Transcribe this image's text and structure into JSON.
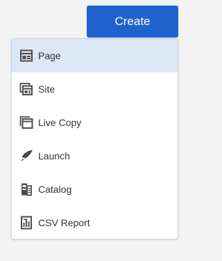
{
  "header": {
    "create_label": "Create"
  },
  "menu": {
    "items": [
      {
        "label": "Page",
        "icon": "page-icon",
        "selected": true
      },
      {
        "label": "Site",
        "icon": "site-icon",
        "selected": false
      },
      {
        "label": "Live Copy",
        "icon": "live-copy-icon",
        "selected": false
      },
      {
        "label": "Launch",
        "icon": "launch-icon",
        "selected": false
      },
      {
        "label": "Catalog",
        "icon": "catalog-icon",
        "selected": false
      },
      {
        "label": "CSV Report",
        "icon": "csv-report-icon",
        "selected": false
      }
    ]
  },
  "colors": {
    "accent": "#2063cd",
    "selected_row": "#dbe6f6",
    "icon": "#4b4b4b"
  }
}
